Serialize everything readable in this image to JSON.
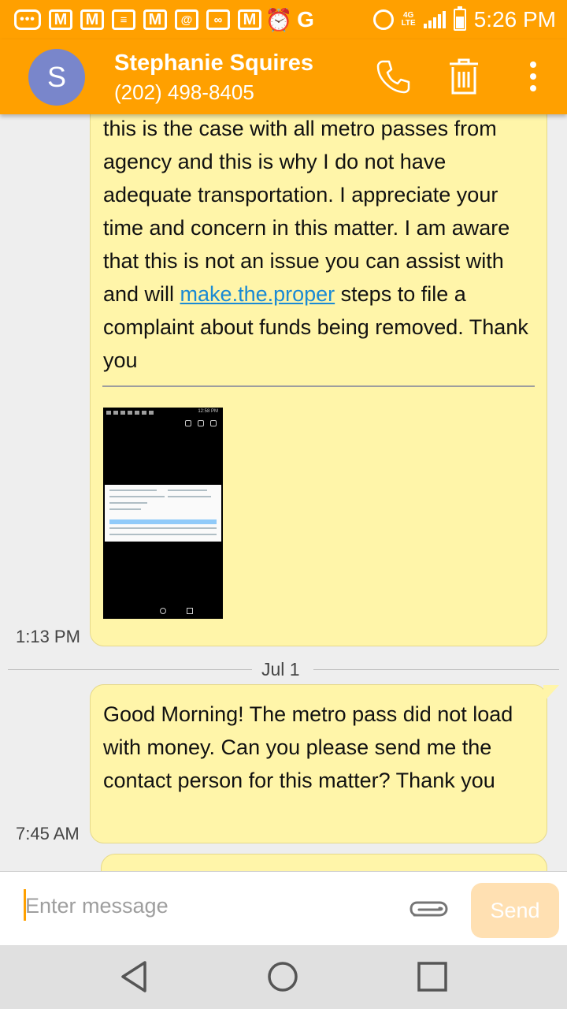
{
  "status_bar": {
    "time": "5:26 PM",
    "network": "4G",
    "network_sub": "LTE",
    "notification_icons": [
      "overflow-icon",
      "gmail-icon",
      "gmail-icon",
      "message-icon",
      "gmail-icon",
      "email-icon",
      "voicemail-icon",
      "gmail-icon",
      "alarm-clock-icon",
      "google-icon"
    ]
  },
  "header": {
    "avatar_letter": "S",
    "contact_name": "Stephanie Squires",
    "contact_phone": "(202) 498-8405",
    "accent_color": "#ffa000"
  },
  "messages": [
    {
      "text_before_link": "this is the case with all metro passes from agency and this is why I do not have adequate transportation. I appreciate your time and concern in this matter. I am aware that this is not an issue you can assist with and will ",
      "link_text": "make.the.proper",
      "text_after_link": " steps to file a complaint about funds being removed. Thank you",
      "time": "1:13 PM",
      "attachment": {
        "type": "image",
        "thumb_time": "12:58 PM"
      }
    },
    {
      "date_separator": "Jul 1",
      "text": "Good Morning! The metro pass did not load with money. Can you please send me the contact person for this matter? Thank you",
      "time": "7:45 AM"
    }
  ],
  "composer": {
    "placeholder": "Enter message",
    "send_label": "Send"
  },
  "bubble_color": "#fff5a9"
}
